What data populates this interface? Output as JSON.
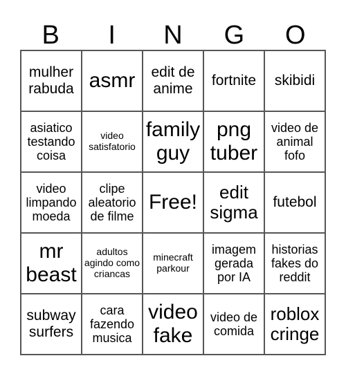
{
  "header": {
    "letters": [
      "B",
      "I",
      "N",
      "G",
      "O"
    ]
  },
  "cells": [
    "mulher rabuda",
    "asmr",
    "edit de anime",
    "fortnite",
    "skibidi",
    "asiatico testando coisa",
    "video satisfatorio",
    "family guy",
    "png tuber",
    "video de animal fofo",
    "video limpando moeda",
    "clipe aleatorio de filme",
    "Free!",
    "edit sigma",
    "futebol",
    "mr beast",
    "adultos agindo como criancas",
    "minecraft parkour",
    "imagem gerada por IA",
    "historias fakes do reddit",
    "subway surfers",
    "cara fazendo musica",
    "video fake",
    "video de comida",
    "roblox cringe"
  ]
}
